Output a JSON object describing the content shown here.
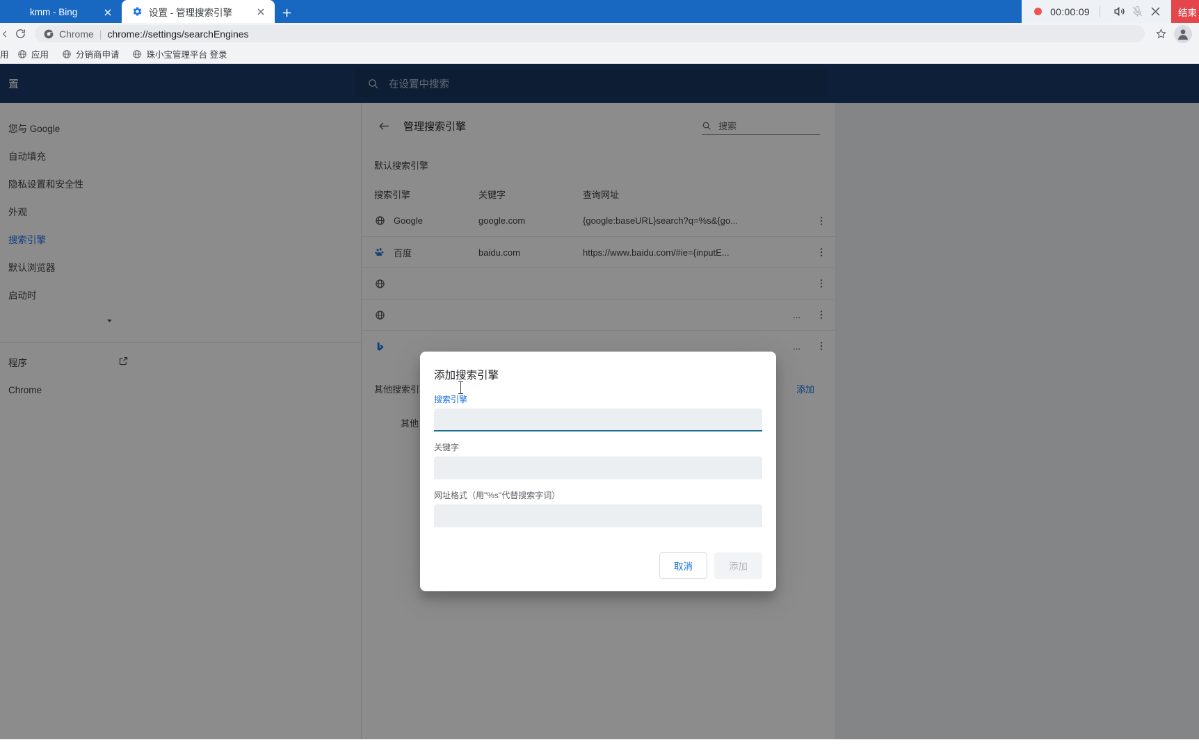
{
  "browser": {
    "tabs": [
      {
        "title": "kmm - Bing",
        "favicon": "globe-icon",
        "active": false
      },
      {
        "title": "设置 - 管理搜索引擎",
        "favicon": "gear-icon",
        "active": true
      }
    ],
    "new_tab_label": "+",
    "omnibox": {
      "scheme": "Chrome",
      "divider": "|",
      "url": "chrome://settings/searchEngines"
    },
    "bookmarks": [
      {
        "label": "用",
        "icon": "globe-icon"
      },
      {
        "label": "应用",
        "icon": "globe-icon"
      },
      {
        "label": "分销商申请",
        "icon": "globe-icon"
      },
      {
        "label": "珠小宝管理平台 登录",
        "icon": "globe-icon"
      }
    ]
  },
  "recorder": {
    "time": "00:00:09",
    "speaker_icon": "speaker-icon",
    "mic_icon": "mic-muted-icon",
    "close_icon": "close-icon",
    "end_label": "结束"
  },
  "settings": {
    "brand": "置",
    "search_placeholder": "在设置中搜索",
    "sidebar": {
      "items": [
        {
          "label": "您与 Google",
          "selected": false
        },
        {
          "label": "自动填充",
          "selected": false
        },
        {
          "label": "隐私设置和安全性",
          "selected": false
        },
        {
          "label": "外观",
          "selected": false
        },
        {
          "label": "搜索引擎",
          "selected": true
        },
        {
          "label": "默认浏览器",
          "selected": false
        },
        {
          "label": "启动时",
          "selected": false
        }
      ],
      "expand_icon": "chevron-down-icon",
      "extension_label": "程序",
      "extension_icon": "open-in-new-icon",
      "about_label": "Chrome"
    },
    "page": {
      "back_icon": "arrow-back-icon",
      "title": "管理搜索引擎",
      "search_placeholder": "搜索",
      "search_icon": "search-icon",
      "default_section_label": "默认搜索引擎",
      "columns": [
        "搜索引擎",
        "关键字",
        "查询网址"
      ],
      "rows": [
        {
          "engine": "Google",
          "icon": "globe-icon",
          "keyword": "google.com",
          "url": "{google:baseURL}search?q=%s&{go...",
          "menu_icon": "more-vert-icon"
        },
        {
          "engine": "百度",
          "icon": "baidu-icon",
          "keyword": "baidu.com",
          "url": "https://www.baidu.com/#ie={inputE...",
          "menu_icon": "more-vert-icon"
        },
        {
          "engine": "",
          "icon": "globe-icon",
          "keyword": "",
          "url": "",
          "menu_icon": "more-vert-icon"
        },
        {
          "engine": "",
          "icon": "globe-icon",
          "keyword": "",
          "url": "...",
          "menu_icon": "more-vert-icon"
        },
        {
          "engine": "",
          "icon": "bing-icon",
          "keyword": "",
          "url": "...",
          "menu_icon": "more-vert-icon"
        }
      ],
      "other_section_label": "其他搜索引擎",
      "other_add_label": "添加",
      "other_sub_label": "其他"
    }
  },
  "dialog": {
    "title": "添加搜索引擎",
    "fields": [
      {
        "label": "搜索引擎",
        "value": "",
        "focused": true
      },
      {
        "label": "关键字",
        "value": "",
        "focused": false
      },
      {
        "label": "网址格式（用\"%s\"代替搜索字词）",
        "value": "",
        "focused": false
      }
    ],
    "cancel_label": "取消",
    "confirm_label": "添加"
  },
  "colors": {
    "accent": "#1a73e8",
    "chrome_blue": "#1867c0",
    "settings_bar": "#1a3a68",
    "record_red": "#e4474b",
    "field_underline": "#1a6d8c"
  }
}
